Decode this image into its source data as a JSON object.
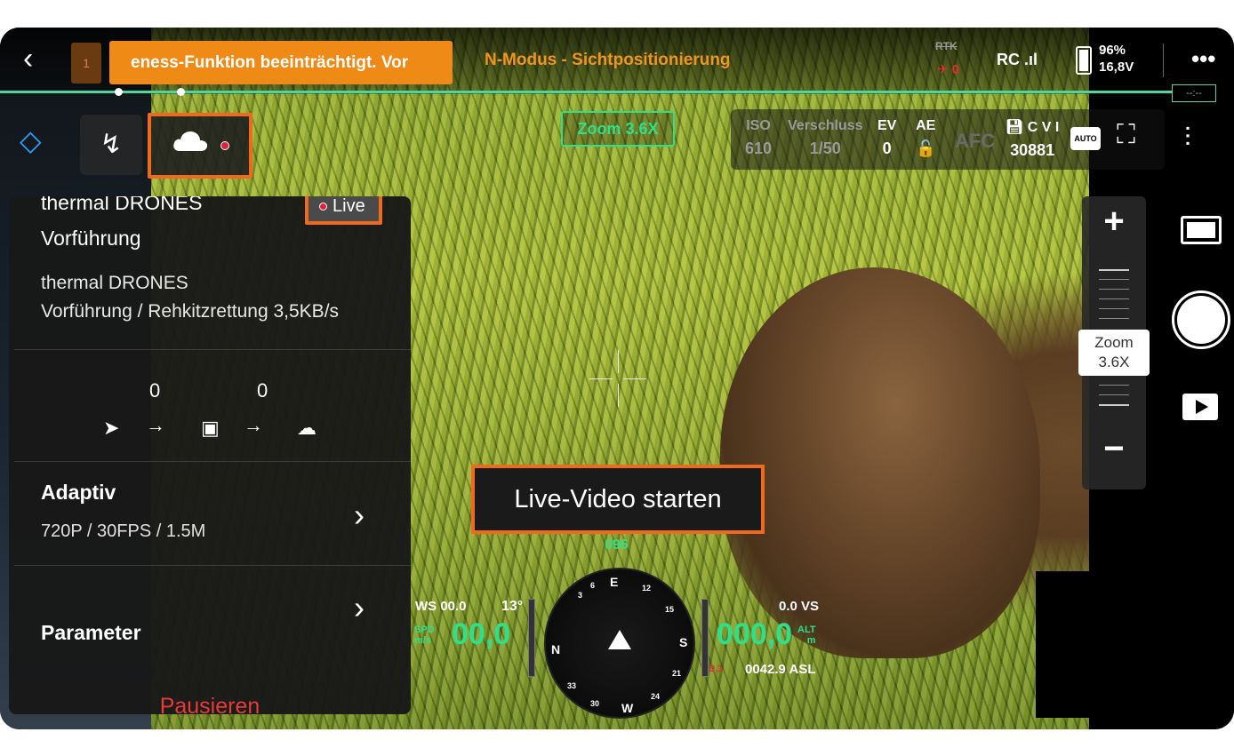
{
  "topbar": {
    "back_icon": "chevron-left-icon",
    "notification_count": "1",
    "warning_text": "eness-Funktion beeinträchtigt. Vor",
    "mode_text": "N-Modus - Sichtpositionierung",
    "rtk_label": "RTK",
    "rtk_value": "0",
    "rc_label": "RC",
    "rc_signal": ".ıl",
    "battery_percent": "96%",
    "battery_voltage": "16,8V",
    "more_label": "•••",
    "line_tag": "--:--"
  },
  "toolbar": {
    "zoom_tag": "Zoom  3.6X"
  },
  "camera_params": {
    "iso_label": "ISO",
    "iso_value": "610",
    "shutter_label": "Verschluss",
    "shutter_value": "1/50",
    "ev_label": "EV",
    "ev_value": "0",
    "ae_label": "AE",
    "ae_icon": "🔓",
    "afc_label": "AFC",
    "storage_label": "C V I",
    "storage_value": "30881",
    "auto_badge": "AUTO"
  },
  "live_panel": {
    "title_line1": "thermal DRONES",
    "title_line2": "Vorführung",
    "live_badge": "Live",
    "subtitle_line1": "thermal DRONES",
    "subtitle_line2": "Vorführung / Rehkitzrettung 3,5KB/s",
    "flow_count_1": "0",
    "flow_count_2": "0",
    "quality_title": "Adaptiv",
    "quality_sub": "720P / 30FPS / 1.5M",
    "parameter_title": "Parameter",
    "pause_label": "Pausieren"
  },
  "overlay": {
    "live_start": "Live-Video starten"
  },
  "zoom_slider": {
    "plus": "+",
    "minus": "−",
    "label_line1": "Zoom",
    "label_line2": "3.6X"
  },
  "telemetry": {
    "heading": "096",
    "ws": "WS 00.0",
    "tilt": "13°",
    "spd_unit1": "SPD",
    "spd_unit2": "m/s",
    "speed": "00,0",
    "vs": "0.0 VS",
    "altitude": "000,0",
    "alt_unit1": "ALT",
    "alt_unit2": "m",
    "asl": "0042.9 ASL",
    "asl_warn": "9,1",
    "compass_n": "N",
    "compass_e": "E",
    "compass_s": "S",
    "compass_w": "W",
    "compass_3": "3",
    "compass_6": "6",
    "compass_12": "12",
    "compass_15": "15",
    "compass_21": "21",
    "compass_24": "24",
    "compass_30": "30",
    "compass_33": "33"
  },
  "colors": {
    "accent_orange": "#f06a1e",
    "warning_orange": "#f08a16",
    "telemetry_green": "#2ee08a",
    "progress_green": "#4ad8a2",
    "pause_red": "#e83a3a"
  }
}
